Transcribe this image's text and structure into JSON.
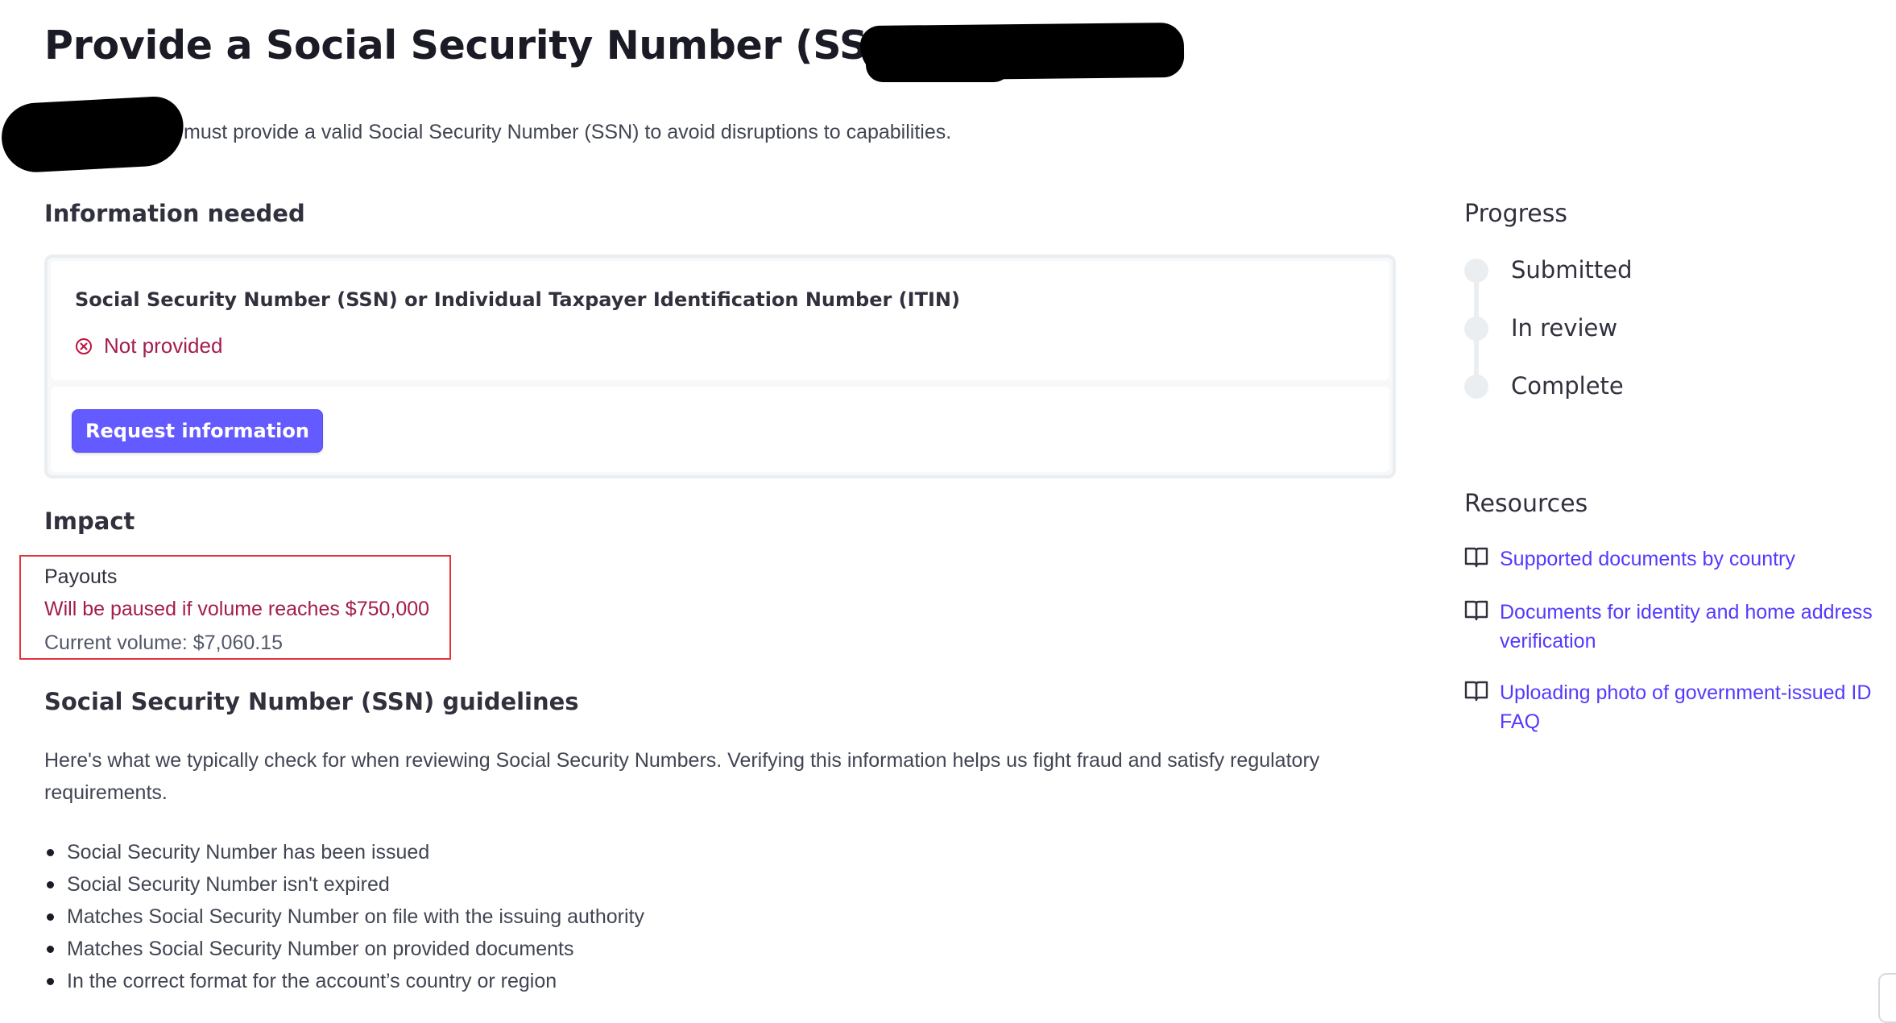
{
  "header": {
    "title": "Provide a Social Security Number (SSN) for",
    "subtitle": "must provide a valid Social Security Number (SSN) to avoid disruptions to capabilities."
  },
  "information_needed": {
    "heading": "Information needed",
    "requirement_title": "Social Security Number (SSN) or Individual Taxpayer Identification Number (ITIN)",
    "status": "Not provided",
    "status_icon": "x-circle-icon",
    "action_label": "Request information"
  },
  "impact": {
    "heading": "Impact",
    "label": "Payouts",
    "warning": "Will be paused if volume reaches $750,000",
    "current_volume": "Current volume: $7,060.15"
  },
  "guidelines": {
    "heading": "Social Security Number (SSN) guidelines",
    "intro": "Here's what we typically check for when reviewing Social Security Numbers. Verifying this information helps us fight fraud and satisfy regulatory requirements.",
    "items": [
      "Social Security Number has been issued",
      "Social Security Number isn't expired",
      "Matches Social Security Number on file with the issuing authority",
      "Matches Social Security Number on provided documents",
      "In the correct format for the account’s country or region"
    ]
  },
  "progress": {
    "heading": "Progress",
    "steps": [
      "Submitted",
      "In review",
      "Complete"
    ]
  },
  "resources": {
    "heading": "Resources",
    "links": [
      "Supported documents by country",
      "Documents for identity and home address verification",
      "Uploading photo of government-issued ID FAQ"
    ],
    "icon": "book-icon"
  },
  "colors": {
    "accent": "#635bff",
    "link": "#533afd",
    "danger": "#a41c4e",
    "highlight_box": "#e5333d"
  }
}
